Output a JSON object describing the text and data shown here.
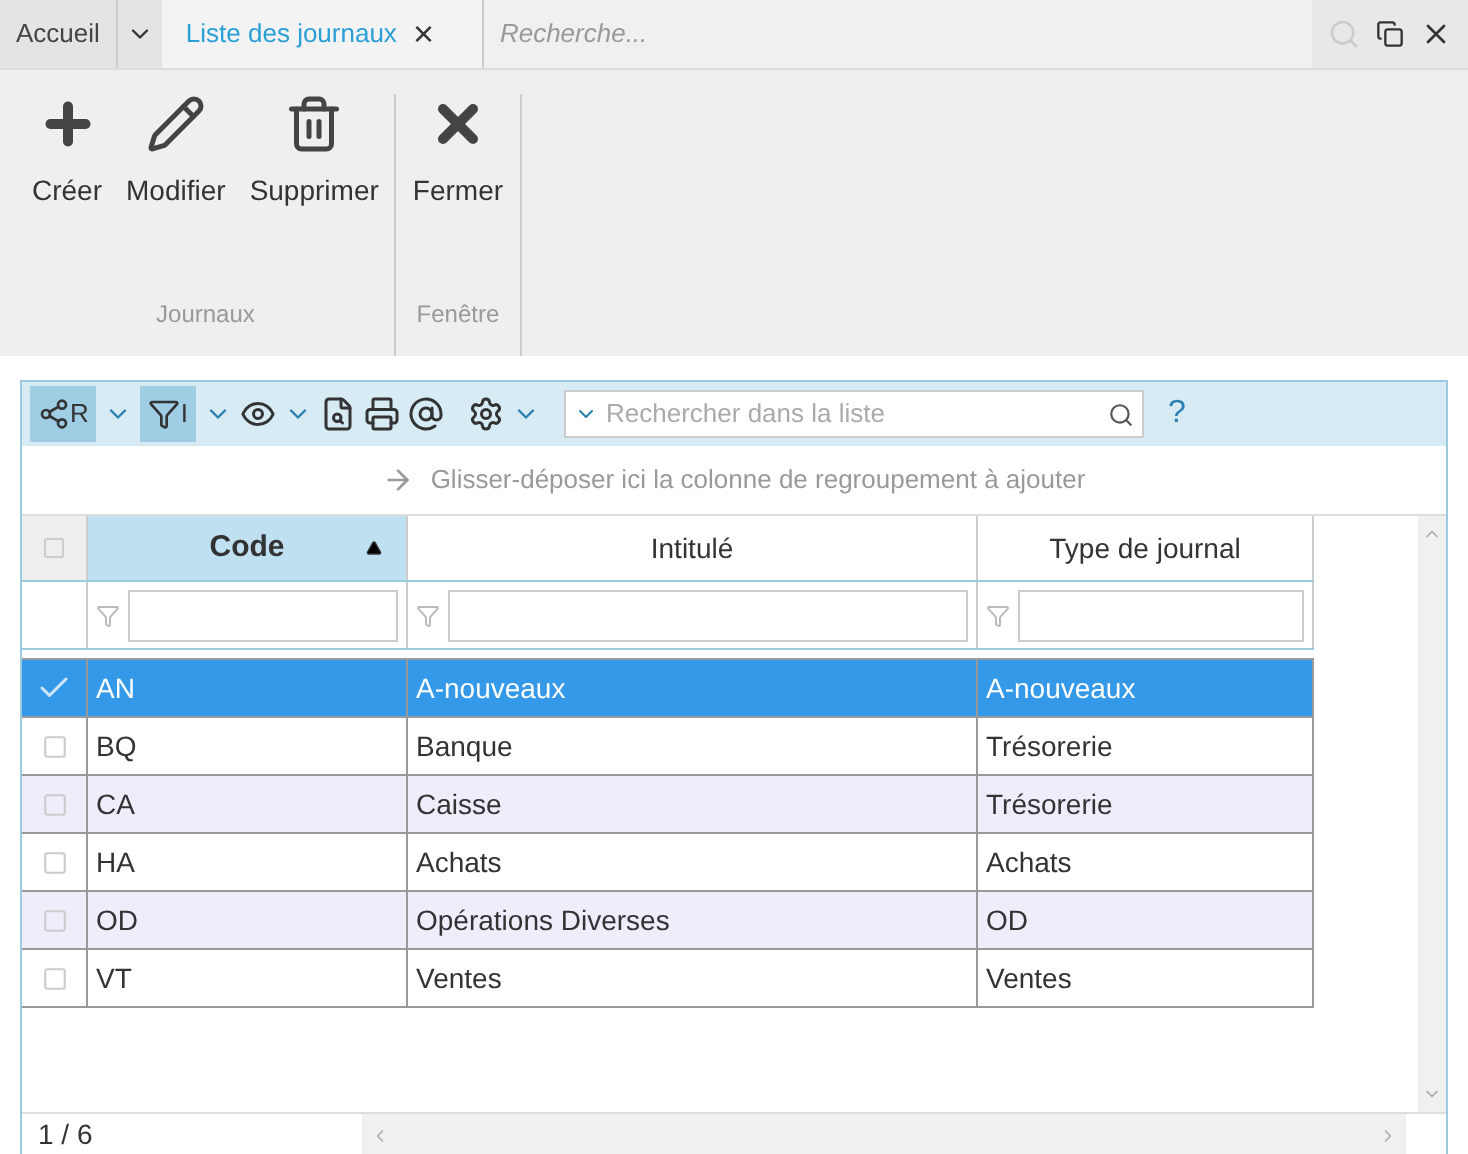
{
  "tabs": [
    {
      "label": "Accueil",
      "selected": false,
      "kind": "menu"
    },
    {
      "label": "Liste des journaux",
      "selected": true,
      "kind": "closable"
    }
  ],
  "tab_close": "×",
  "search": {
    "placeholder": "Recherche..."
  },
  "ribbon": {
    "groups": [
      {
        "label": "Journaux",
        "buttons": [
          {
            "label": "Créer",
            "kind": "create"
          },
          {
            "label": "Modifier",
            "kind": "edit"
          },
          {
            "label": "Supprimer",
            "kind": "delete"
          }
        ]
      },
      {
        "label": "Fenêtre",
        "buttons": [
          {
            "label": "Fermer",
            "kind": "close"
          }
        ]
      }
    ]
  },
  "toolbar": {
    "group_label": "R",
    "filter_label": "I",
    "list_search": {
      "placeholder": "Rechercher dans la liste"
    },
    "help": "?"
  },
  "group_hint": "Glisser-déposer ici la colonne de regroupement à ajouter",
  "table": {
    "all_checked": false,
    "columns": [
      {
        "label": "Code",
        "sorted": true
      },
      {
        "label": "Intitulé",
        "sorted": false
      },
      {
        "label": "Type de journal",
        "sorted": false
      }
    ],
    "rows": [
      {
        "cells": [
          "AN",
          "A-nouveaux",
          "A-nouveaux"
        ],
        "selected": true
      },
      {
        "cells": [
          "BQ",
          "Banque",
          "Trésorerie"
        ],
        "selected": false
      },
      {
        "cells": [
          "CA",
          "Caisse",
          "Trésorerie"
        ],
        "selected": false
      },
      {
        "cells": [
          "HA",
          "Achats",
          "Achats"
        ],
        "selected": false
      },
      {
        "cells": [
          "OD",
          "Opérations Diverses",
          "OD"
        ],
        "selected": false
      },
      {
        "cells": [
          "VT",
          "Ventes",
          "Ventes"
        ],
        "selected": false
      }
    ]
  },
  "footer": {
    "count": "1 / 6"
  }
}
